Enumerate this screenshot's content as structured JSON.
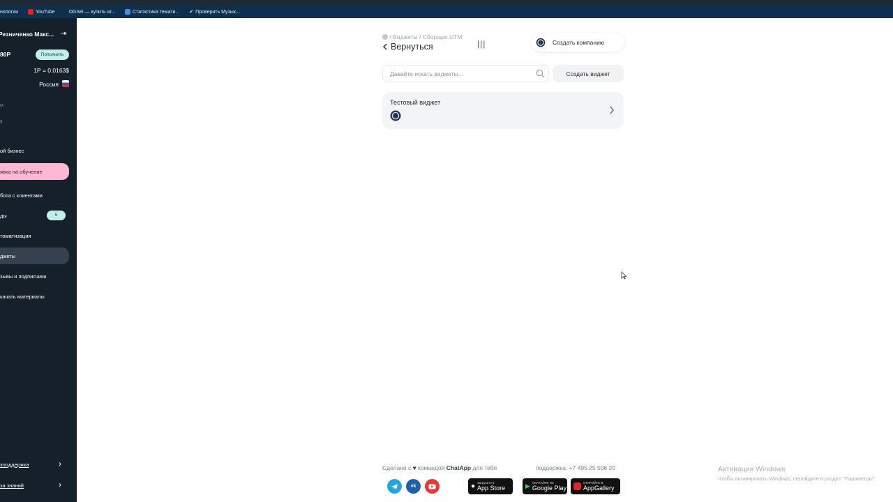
{
  "bookmarks": [
    {
      "label": "нологии",
      "color": ""
    },
    {
      "label": "YouTube",
      "color": "#e62117"
    },
    {
      "label": "OGSei — купить иг...",
      "color": ""
    },
    {
      "label": "Статистика темати...",
      "color": "#4a90d9"
    },
    {
      "label": "Проверить Музык...",
      "color": "#ffffff"
    }
  ],
  "sidebar": {
    "user_name": "Резниченко Макс...",
    "balance": "80Р",
    "topup_label": "Пополнить",
    "rate": "1Р = 0.0163$",
    "country": "Россия",
    "section_label": "м",
    "items": [
      {
        "label": "т"
      },
      {
        "label": "ой бизнес"
      },
      {
        "label": "явка на обучение"
      },
      {
        "label": "бота с клиентами"
      },
      {
        "label": "ды",
        "badge": "5"
      },
      {
        "label": "томатизация"
      },
      {
        "label": "джеты"
      },
      {
        "label": "зывы и подписчики"
      },
      {
        "label": "качать материалы"
      }
    ],
    "support_label": "хподдержка",
    "knowledge_label": "за знаний"
  },
  "main": {
    "breadcrumbs": "/ Виджеты / Сборщик UTM",
    "back_label": "Вернуться",
    "create_company_label": "Создать компанию",
    "search_placeholder": "Давайте искать виджеты...",
    "create_widget_label": "Создать виджет",
    "widget_card_title": "Тестовый виджет"
  },
  "footer": {
    "made_prefix": "Сделано с",
    "made_middle": "командой",
    "brand": "ChatApp",
    "made_suffix": "для тебя",
    "support_text": "поддержка: +7 495 25 506 20",
    "stores": [
      {
        "small": "Загрузите в",
        "big": "App Store"
      },
      {
        "small": "СКАЧАЙТЕ ИЗ",
        "big": "Google Play"
      },
      {
        "small": "ОТКРОЙТЕ В",
        "big": "AppGallery"
      }
    ],
    "socials": [
      "telegram",
      "vk",
      "youtube"
    ]
  },
  "activation": {
    "title": "Активация Windows",
    "subtitle": "Чтобы активировать Windows, перейдите в раздел \"Параметры\"."
  },
  "colors": {
    "sidebar_bg": "#16202b",
    "accent_mint": "#bff0e8",
    "highlight_pink": "#ffb8d2"
  }
}
